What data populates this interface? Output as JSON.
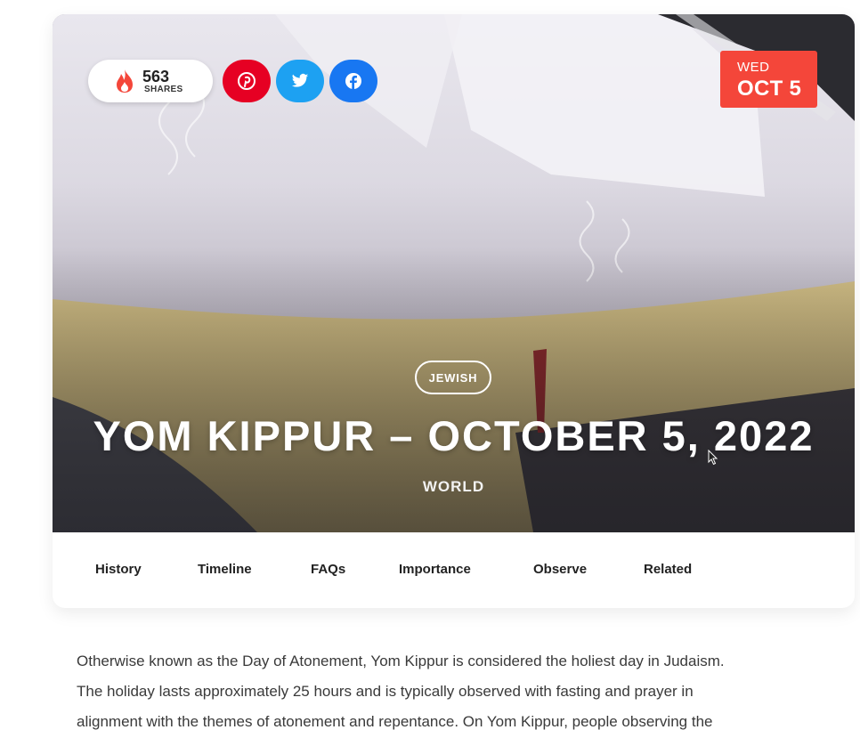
{
  "shares": {
    "count": "563",
    "label": "SHARES",
    "icon": "flame-icon"
  },
  "social": [
    {
      "name": "pinterest",
      "icon": "pinterest-icon",
      "color": "#e60023"
    },
    {
      "name": "twitter",
      "icon": "twitter-icon",
      "color": "#1da1f2"
    },
    {
      "name": "facebook",
      "icon": "facebook-icon",
      "color": "#1877f2"
    }
  ],
  "date_badge": {
    "day": "WED",
    "date": "OCT 5",
    "color": "#f4463a"
  },
  "hero": {
    "tag": "JEWISH",
    "title": "YOM KIPPUR – OCTOBER 5, 2022",
    "subtitle": "WORLD"
  },
  "nav": {
    "items": [
      {
        "label": "History"
      },
      {
        "label": "Timeline"
      },
      {
        "label": "FAQs"
      },
      {
        "label": "Importance"
      },
      {
        "label": "Observe"
      },
      {
        "label": "Related"
      }
    ]
  },
  "content": {
    "lines": [
      "Otherwise known as the Day of Atonement, Yom Kippur is considered the holiest day in Judaism.",
      "The holiday lasts approximately 25 hours and is typically observed with fasting and prayer in",
      "alignment with the themes of atonement and repentance. On Yom Kippur, people observing the"
    ]
  }
}
